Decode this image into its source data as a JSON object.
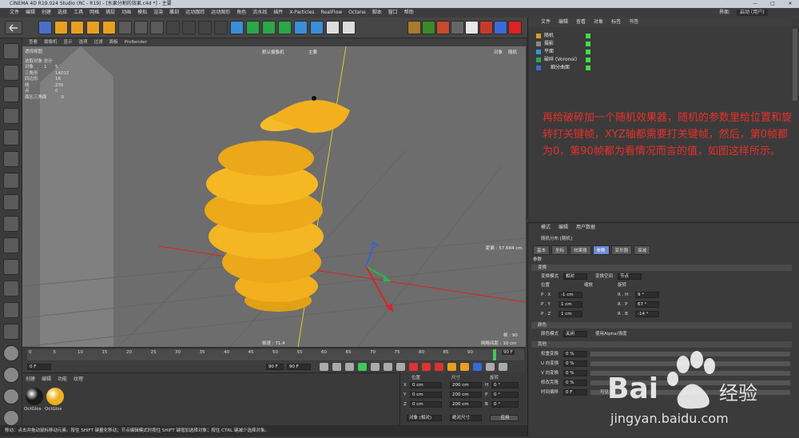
{
  "window": {
    "title": "CINEMA 4D R19.024 Studio (RC - R19) - [水果分割的效果.c4d *] - 主要",
    "controls": [
      "—",
      "□",
      "✕"
    ]
  },
  "menu": [
    "文件",
    "编辑",
    "创建",
    "选择",
    "工具",
    "网格",
    "捕捉",
    "动画",
    "模拟",
    "渲染",
    "雕刻",
    "运动跟踪",
    "运动图形",
    "角色",
    "流水线",
    "插件",
    "X-Particles",
    "RealFlow",
    "Octane",
    "脚本",
    "窗口",
    "帮助"
  ],
  "right_menu": {
    "interface_label": "界面:",
    "interface_value": "启动 (用户)"
  },
  "viewport": {
    "menu": [
      "查看",
      "摄像机",
      "显示",
      "选项",
      "过滤",
      "面板",
      "ProRender"
    ],
    "view_label": "透视视图",
    "camera_label": "默认摄像机",
    "top_labels": [
      "主要"
    ],
    "corner_buttons": [
      "对象",
      "随机"
    ],
    "stats": {
      "header": "选取对象  总计",
      "rows": [
        [
          "对象",
          "1",
          "5"
        ],
        [
          "三角形",
          "",
          "14032"
        ],
        [
          "四边形",
          "",
          "16"
        ],
        [
          "线",
          "",
          "235"
        ],
        [
          "点",
          "",
          "0"
        ],
        [
          "面比三角面",
          "",
          "0"
        ]
      ]
    },
    "grid_spacing": "网格间距 : 10 cm",
    "distance": "距离 : 57.684 cm",
    "speed": "帧速 : 71.4",
    "frame_label": "帧 : 90"
  },
  "timeline": {
    "ticks": [
      "0",
      "5",
      "10",
      "15",
      "20",
      "25",
      "30",
      "35",
      "40",
      "45",
      "50",
      "55",
      "60",
      "65",
      "70",
      "75",
      "80",
      "85",
      "90"
    ],
    "current": "90 F",
    "start": "0 F",
    "end": "90 F",
    "min": "0 F",
    "max": "90 F"
  },
  "materials": {
    "menu": [
      "创建",
      "编辑",
      "功能",
      "纹理"
    ],
    "items": [
      {
        "name": "OctGlos",
        "color": "#1a1a1a"
      },
      {
        "name": "OctGlos",
        "color": "#f0b020"
      }
    ]
  },
  "coords": {
    "headers": [
      "位置",
      "尺寸",
      "旋转"
    ],
    "rows": [
      {
        "axis": "X",
        "pos": "0 cm",
        "size": "200 cm",
        "rot_label": "H",
        "rot": "0 °"
      },
      {
        "axis": "Y",
        "pos": "0 cm",
        "size": "200 cm",
        "rot_label": "P",
        "rot": "0 °"
      },
      {
        "axis": "Z",
        "pos": "0 cm",
        "size": "200 cm",
        "rot_label": "B",
        "rot": "0 °"
      }
    ],
    "mode": "对象 (相对)",
    "size_mode": "绝对尺寸",
    "apply": "应用"
  },
  "object_manager": {
    "tabs": [
      "文件",
      "编辑",
      "查看",
      "对象",
      "标签",
      "书签"
    ],
    "objects": [
      "随机",
      "摄影",
      "平面",
      "破碎 (Voronoi)",
      "细分曲面"
    ],
    "note": "再给破碎加一个随机效果器，随机的参数里给位置和旋转打关键帧，XYZ轴都需要打关键帧，然后，第0帧都为0，第90帧都为看情况而言的值，如图这样所示。"
  },
  "attributes": {
    "menu": [
      "模式",
      "编辑",
      "用户数据"
    ],
    "object_title": "随机分布 [随机]",
    "tabs": [
      "基本",
      "坐标",
      "效果器",
      "参数",
      "变形器",
      "衰减"
    ],
    "active_tab": "参数",
    "params_label": "参数",
    "section_transform": "变换",
    "transform_mode_label": "变换模式",
    "transform_mode": "相对",
    "transform_space_label": "变换空间",
    "transform_space": "节点",
    "position_label": "位置",
    "scale_label": "缩放",
    "rotation_label": "旋转",
    "pos_rows": [
      [
        "P . X",
        "-1 cm"
      ],
      [
        "P . Y",
        "1 cm"
      ],
      [
        "P . Z",
        "1 cm"
      ]
    ],
    "rot_rows": [
      [
        "R . H",
        "9 °"
      ],
      [
        "R . P",
        "67 °"
      ],
      [
        "R . B",
        "-14 °"
      ]
    ],
    "section_color": "颜色",
    "color_mode_label": "颜色模式",
    "color_mode": "关闭",
    "use_alpha": "使用Alpha/强度",
    "section_other": "其他",
    "other_rows": [
      [
        "权重变换",
        "0 %"
      ],
      [
        "U 向变换",
        "0 %"
      ],
      [
        "V 向变换",
        "0 %"
      ],
      [
        "修改克隆",
        "0 %"
      ],
      [
        "时间偏移",
        "0 F"
      ]
    ],
    "visible_label": "可见"
  },
  "statusbar": "移动：点击并拖动鼠标移动元素。按住 SHIFT 键量化移动；节点编辑模式时按住 SHIFT 键增加选择对象；按住 CTRL 键减少选择对象。",
  "watermark": {
    "brand": "Bai",
    "cn": "经验",
    "url": "jingyan.baidu.com"
  },
  "colors": {
    "accent": "#6b8bd1",
    "fruit": "#f2b01e",
    "note": "#e8302b"
  }
}
